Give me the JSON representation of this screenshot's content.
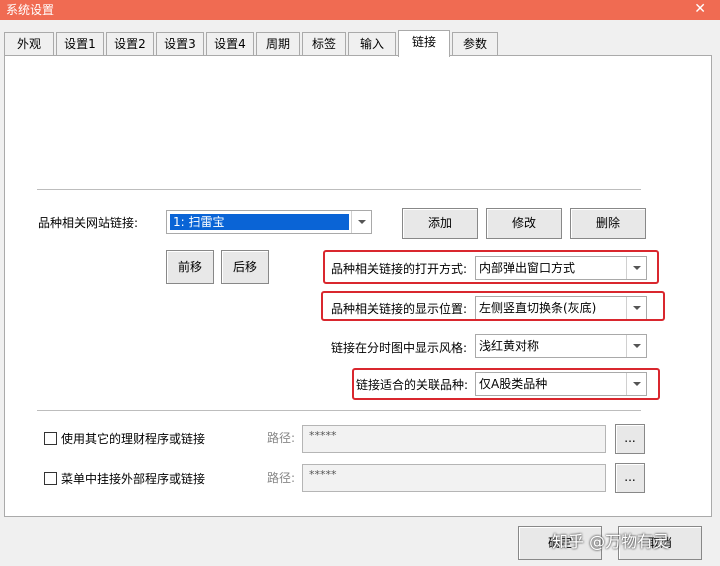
{
  "window": {
    "title": "系统设置"
  },
  "tabs": [
    "外观",
    "设置1",
    "设置2",
    "设置3",
    "设置4",
    "周期",
    "标签",
    "输入",
    "链接",
    "参数"
  ],
  "active_tab": "链接",
  "link_section": {
    "site_label": "品种相关网站链接:",
    "site_value": "1: 扫雷宝",
    "add": "添加",
    "edit": "修改",
    "delete": "删除",
    "move_up": "前移",
    "move_down": "后移"
  },
  "options": {
    "open_mode_label": "品种相关链接的打开方式:",
    "open_mode_value": "内部弹出窗口方式",
    "display_pos_label": "品种相关链接的显示位置:",
    "display_pos_value": "左侧竖直切换条(灰底)",
    "style_label": "链接在分时图中显示风格:",
    "style_value": "浅红黄对称",
    "apply_label": "链接适合的关联品种:",
    "apply_value": "仅A股类品种"
  },
  "external": {
    "use_other_label": "使用其它的理财程序或链接",
    "menu_external_label": "菜单中挂接外部程序或链接",
    "path_label": "路径:",
    "path_placeholder": "*****",
    "browse": "..."
  },
  "footer": {
    "ok": "确定",
    "cancel": "取消"
  },
  "watermark": "知乎 @万物有灵",
  "colors": {
    "titlebar": "#f06b52",
    "highlight_box": "#d9272e",
    "selection": "#0a64d6"
  }
}
